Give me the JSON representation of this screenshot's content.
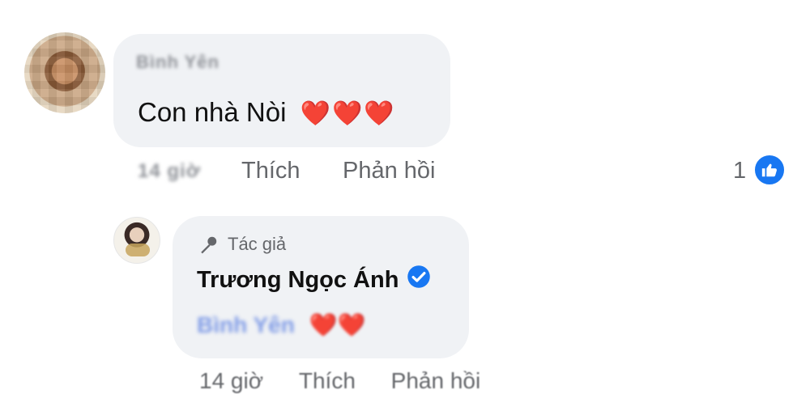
{
  "comment": {
    "author": "Bình Yên",
    "text": "Con nhà Nòi",
    "hearts": "❤️❤️❤️",
    "time": "14 giờ",
    "actions": {
      "like": "Thích",
      "reply": "Phản hồi"
    },
    "reaction_count": "1"
  },
  "reply": {
    "author_tag": "Tác giả",
    "author": "Trương Ngọc Ánh",
    "mention": "Bình Yên",
    "hearts": "❤️❤️"
  },
  "bottom_actions": {
    "time": "14 giờ",
    "like": "Thích",
    "reply": "Phản hồi"
  },
  "colors": {
    "bubble": "#f0f2f5",
    "meta_text": "#65676b",
    "accent_blue": "#1877f2",
    "heart_red": "#e02828"
  },
  "icons": {
    "verified": "verified-icon",
    "like": "thumbs-up-icon",
    "author": "microphone-icon"
  }
}
